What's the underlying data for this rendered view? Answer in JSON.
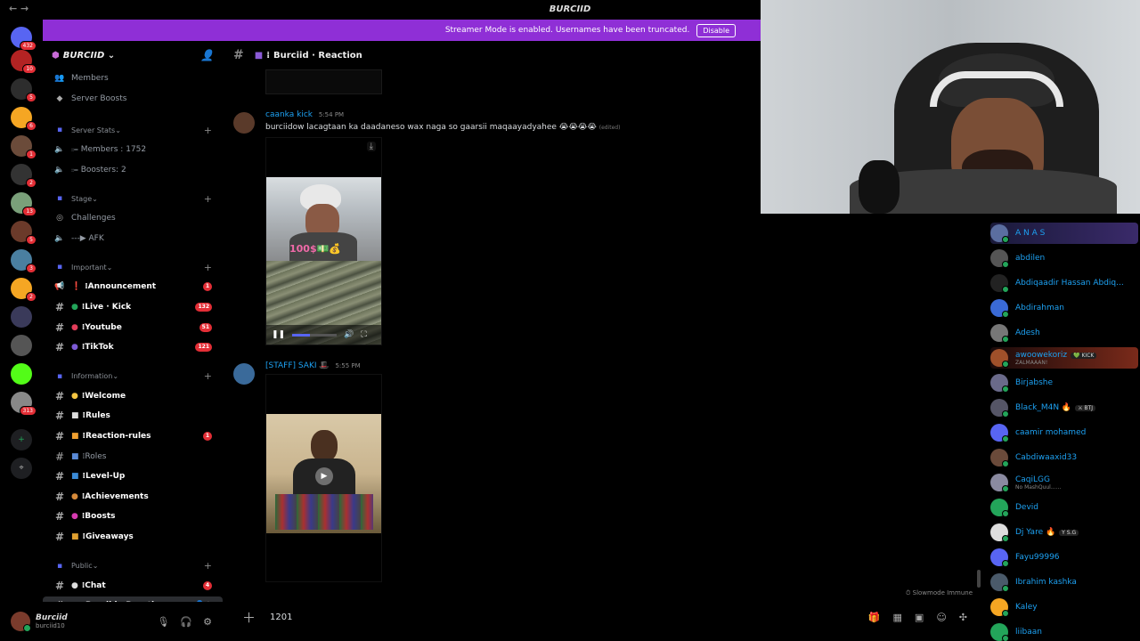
{
  "window": {
    "title": "BURCIID",
    "nav": "← →"
  },
  "banner": {
    "text": "Streamer Mode is enabled. Usernames have been truncated.",
    "button": "Disable",
    "bg": "#8f2fd6"
  },
  "server_rail": {
    "items": [
      {
        "name": "direct-messages",
        "badge": "432",
        "color": "#5865f2"
      },
      {
        "name": "server-1",
        "badge": "10",
        "color": "#b32323"
      },
      {
        "name": "server-2",
        "badge": "5",
        "color": "#2d2d2d"
      },
      {
        "name": "server-3",
        "badge": "6",
        "color": "#f5a623"
      },
      {
        "name": "server-4",
        "badge": "1",
        "color": "#6b4b3a"
      },
      {
        "name": "server-5",
        "badge": "2",
        "color": "#333"
      },
      {
        "name": "server-6",
        "badge": "13",
        "color": "#7aa07a"
      },
      {
        "name": "server-7",
        "badge": "5",
        "color": "#6b3a2a"
      },
      {
        "name": "server-8",
        "badge": "3",
        "color": "#4a7fa0"
      },
      {
        "name": "server-9",
        "badge": "2",
        "color": "#f5a623"
      },
      {
        "name": "server-10",
        "badge": "",
        "color": "#3a3a5a"
      },
      {
        "name": "server-11",
        "badge": "",
        "color": "#555"
      },
      {
        "name": "server-12",
        "badge": "",
        "color": "#53fc18"
      },
      {
        "name": "server-13",
        "badge": "313",
        "color": "#888"
      }
    ]
  },
  "sidebar": {
    "server_name": "BURCIID",
    "top_items": [
      "Members",
      "Server Boosts"
    ],
    "categories": [
      {
        "label": "Server Stats",
        "channels": [
          {
            "label": "⩴ Members : 1752",
            "kind": "voice",
            "bold": false
          },
          {
            "label": "⩴ Boosters: 2",
            "kind": "voice",
            "bold": false
          }
        ]
      },
      {
        "label": "Stage",
        "channels": [
          {
            "label": "Challenges",
            "kind": "stage",
            "bold": false
          },
          {
            "label": "---▶ AFK",
            "kind": "voice",
            "bold": false
          }
        ]
      },
      {
        "label": "Important",
        "channels": [
          {
            "label": "Announcement",
            "kind": "announce",
            "badge": "1",
            "bold": true,
            "emoji": "❗",
            "emoji_color": "#e23"
          },
          {
            "label": "Live · Kick",
            "kind": "text",
            "badge": "132",
            "bold": true,
            "emoji": "●",
            "emoji_color": "#23a55a"
          },
          {
            "label": "Youtube",
            "kind": "text",
            "badge": "51",
            "bold": true,
            "emoji": "●",
            "emoji_color": "#e23d5a"
          },
          {
            "label": "TikTok",
            "kind": "text",
            "badge": "121",
            "bold": true,
            "emoji": "●",
            "emoji_color": "#7d5ad6"
          }
        ]
      },
      {
        "label": "Information",
        "channels": [
          {
            "label": "Welcome",
            "kind": "text",
            "bold": true,
            "emoji": "●",
            "emoji_color": "#f5c542"
          },
          {
            "label": "Rules",
            "kind": "text",
            "bold": true,
            "emoji": "■",
            "emoji_color": "#ddd"
          },
          {
            "label": "Reaction-rules",
            "kind": "text",
            "badge": "1",
            "bold": true,
            "emoji": "■",
            "emoji_color": "#f0a030"
          },
          {
            "label": "Roles",
            "kind": "text",
            "bold": false,
            "emoji": "■",
            "emoji_color": "#5a8ad6"
          },
          {
            "label": "Level-Up",
            "kind": "text",
            "bold": true,
            "emoji": "■",
            "emoji_color": "#3a8ad6"
          },
          {
            "label": "Achievements",
            "kind": "text",
            "bold": true,
            "emoji": "●",
            "emoji_color": "#d68a3a"
          },
          {
            "label": "Boosts",
            "kind": "text",
            "bold": true,
            "emoji": "●",
            "emoji_color": "#d63ab0"
          },
          {
            "label": "Giveaways",
            "kind": "text",
            "bold": true,
            "emoji": "■",
            "emoji_color": "#e0a030"
          }
        ]
      },
      {
        "label": "Public",
        "channels": [
          {
            "label": "Chat",
            "kind": "text",
            "badge": "4",
            "bold": true,
            "emoji": "●",
            "emoji_color": "#ddd"
          },
          {
            "label": "Burciid · Reaction",
            "kind": "text",
            "bold": true,
            "selected": true,
            "emoji": "■",
            "emoji_color": "#8a5ad6"
          }
        ]
      }
    ]
  },
  "user": {
    "name": "Burciid",
    "tag": "burciid10"
  },
  "channel": {
    "name": "Burciid · Reaction"
  },
  "messages": [
    {
      "author": "caanka kick",
      "time": "5:54 PM",
      "text": "burciidow lacagtaan ka daadaneso wax naga so gaarsii maqaayadyahee 😭😭😭😭",
      "edited": "(edited)",
      "video_caption": "100$💵💰"
    },
    {
      "author": "[STAFF] SAKI 🎩",
      "time": "5:55 PM",
      "text": "",
      "video_caption": ""
    }
  ],
  "composer": {
    "value": "1201",
    "slowmode": "Slowmode Immune"
  },
  "members": [
    {
      "name": "A N A S",
      "sub": "",
      "tag": "",
      "color": "#5b6ea0",
      "highlight": true
    },
    {
      "name": "abdilen",
      "sub": "",
      "tag": "",
      "color": "#555"
    },
    {
      "name": "Abdiqaadir Hassan Abdiq...",
      "sub": "",
      "tag": "",
      "color": "#222"
    },
    {
      "name": "Abdirahman",
      "sub": "",
      "tag": "",
      "color": "#3a6ad6"
    },
    {
      "name": "Adesh",
      "sub": "",
      "tag": "",
      "color": "#777"
    },
    {
      "name": "awoowekoriz",
      "sub": "ZALMAAAN!",
      "tag": "💚 KICK",
      "color": "#a0502a",
      "highlight2": true
    },
    {
      "name": "Birjabshe",
      "sub": "",
      "tag": "",
      "color": "#6a6a8a"
    },
    {
      "name": "Black_M4N 🔥",
      "sub": "",
      "tag": "⚔ BTJ",
      "color": "#556"
    },
    {
      "name": "caamir mohamed",
      "sub": "",
      "tag": "",
      "color": "#5865f2"
    },
    {
      "name": "Cabdiwaaxid33",
      "sub": "",
      "tag": "",
      "color": "#6a4a3a"
    },
    {
      "name": "CaqiLGG",
      "sub": "No MashQuul......",
      "tag": "",
      "color": "#8a8aa0"
    },
    {
      "name": "Devid",
      "sub": "",
      "tag": "",
      "color": "#23a55a"
    },
    {
      "name": "Dj Yare 🔥",
      "sub": "",
      "tag": "Y S.G",
      "color": "#ddd"
    },
    {
      "name": "Fayu99996",
      "sub": "",
      "tag": "",
      "color": "#5865f2"
    },
    {
      "name": "Ibrahim kashka",
      "sub": "",
      "tag": "",
      "color": "#4a5a6a"
    },
    {
      "name": "Kaley",
      "sub": "",
      "tag": "",
      "color": "#f5a623"
    },
    {
      "name": "liibaan",
      "sub": "",
      "tag": "",
      "color": "#23a55a"
    }
  ]
}
